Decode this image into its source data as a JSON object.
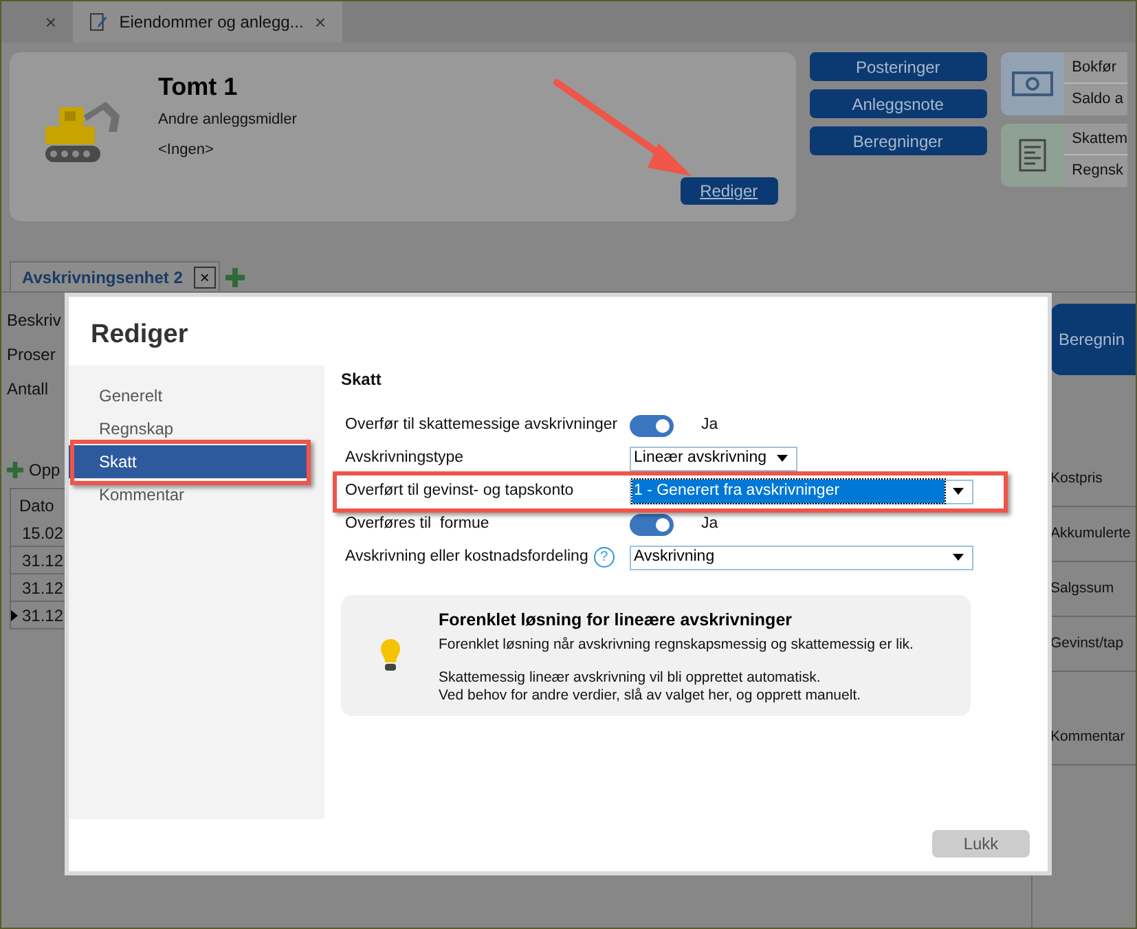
{
  "app_tabs": [
    {
      "close": "×",
      "selected": false
    },
    {
      "label": "Eiendommer og anlegg...",
      "close": "×",
      "selected": true
    }
  ],
  "asset": {
    "title": "Tomt 1",
    "category": "Andre anleggsmidler",
    "group": "<Ingen>",
    "edit_button": "Rediger"
  },
  "actions": [
    "Posteringer",
    "Anleggsnote",
    "Beregninger"
  ],
  "summary_cards": [
    {
      "kind": "money",
      "lines": [
        "Bokfør",
        "Saldo a"
      ]
    },
    {
      "kind": "ledger",
      "lines": [
        "Skattem",
        "Regnsk"
      ]
    }
  ],
  "unit_tabs": [
    {
      "label": "Avskrivningsenhet 2",
      "close": "×",
      "selected": true
    }
  ],
  "left_fields": [
    "Beskriv",
    "Proser",
    "Antall"
  ],
  "toolbar": {
    "add": "Opp"
  },
  "table": {
    "columns": [
      "Dato"
    ],
    "rows": [
      {
        "cells": [
          "15.02"
        ],
        "current": false
      },
      {
        "cells": [
          "31.12"
        ],
        "current": false
      },
      {
        "cells": [
          "31.12"
        ],
        "current": false
      },
      {
        "cells": [
          "31.12"
        ],
        "current": true
      }
    ]
  },
  "right_panel": {
    "button": "Beregnin",
    "labels": [
      "Kostpris",
      "Akkumulerte",
      "Salgssum",
      "Gevinst/tap",
      "Kommentar"
    ]
  },
  "dialog": {
    "title": "Rediger",
    "nav": [
      {
        "label": "Generelt",
        "selected": false
      },
      {
        "label": "Regnskap",
        "selected": false
      },
      {
        "label": "Skatt",
        "selected": true
      },
      {
        "label": "Kommentar",
        "selected": false
      }
    ],
    "section": "Skatt",
    "fields": [
      {
        "kind": "toggle",
        "label": "Overfør til skattemessige avskrivninger",
        "on": true,
        "value": "Ja"
      },
      {
        "kind": "dropdown",
        "label": "Avskrivningstype",
        "value": "Lineær avskrivning",
        "focused": false
      },
      {
        "kind": "wide_dropdown",
        "label": "Overført til gevinst- og tapskonto",
        "value": "1 - Generert fra avskrivninger",
        "focused": true
      },
      {
        "kind": "toggle",
        "label": "Overføres til  formue",
        "on": true,
        "value": "Ja"
      },
      {
        "kind": "wide_dropdown",
        "label": "Avskrivning eller kostnadsfordeling",
        "help": "?",
        "value": "Avskrivning",
        "focused": false
      }
    ],
    "info": {
      "title": "Forenklet løsning for lineære avskrivninger",
      "paragraphs": [
        "Forenklet løsning når avskrivning regnskapsmessig og skattemessig er lik.",
        "Skattemessig lineær avskrivning vil bli opprettet automatisk.\nVed behov for andre verdier, slå av valget her, og opprett manuelt."
      ]
    },
    "close_button": "Lukk"
  }
}
